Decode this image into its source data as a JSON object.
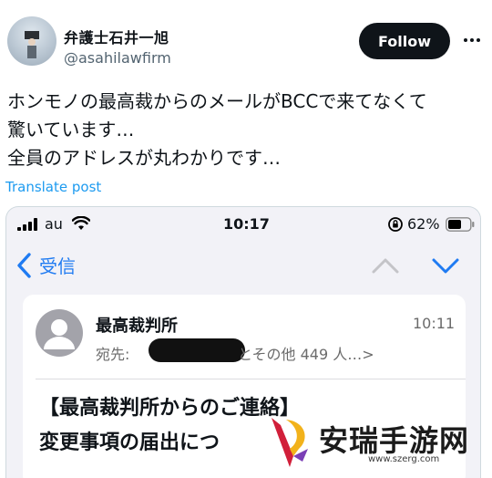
{
  "author": {
    "name": "弁護士石井一旭",
    "handle": "@asahilawfirm",
    "follow_label": "Follow"
  },
  "tweet": {
    "lines": [
      "ホンモノの最高裁からのメールがBCCで来てなくて",
      "驚いています…",
      "全員のアドレスが丸わかりです…"
    ],
    "translate_label": "Translate post"
  },
  "phone": {
    "status": {
      "carrier": "au",
      "time": "10:17",
      "battery_percent": "62%",
      "battery_level": 0.62
    },
    "nav": {
      "back_label": "受信"
    },
    "mail": {
      "sender": "最高裁判所",
      "time": "10:11",
      "to_label": "宛先:",
      "to_others": "とその他 449 人…>",
      "subject_line1": "【最高裁判所からのご連絡】",
      "subject_line2": "変更事項の届出につ"
    }
  },
  "watermark": {
    "title": "安瑞手游网",
    "url": "www.szerg.com"
  },
  "colors": {
    "follow_bg": "#0f1419",
    "link_blue": "#1d9bf0",
    "ios_blue": "#1f7bf2",
    "ios_bg": "#f2f2f7"
  },
  "icons": [
    "avatar",
    "more-horizontal-icon",
    "signal-icon",
    "wifi-icon",
    "orientation-lock-icon",
    "battery-icon",
    "chevron-left-icon",
    "chevron-up-icon",
    "chevron-down-icon",
    "contact-avatar-icon",
    "watermark-logo"
  ]
}
